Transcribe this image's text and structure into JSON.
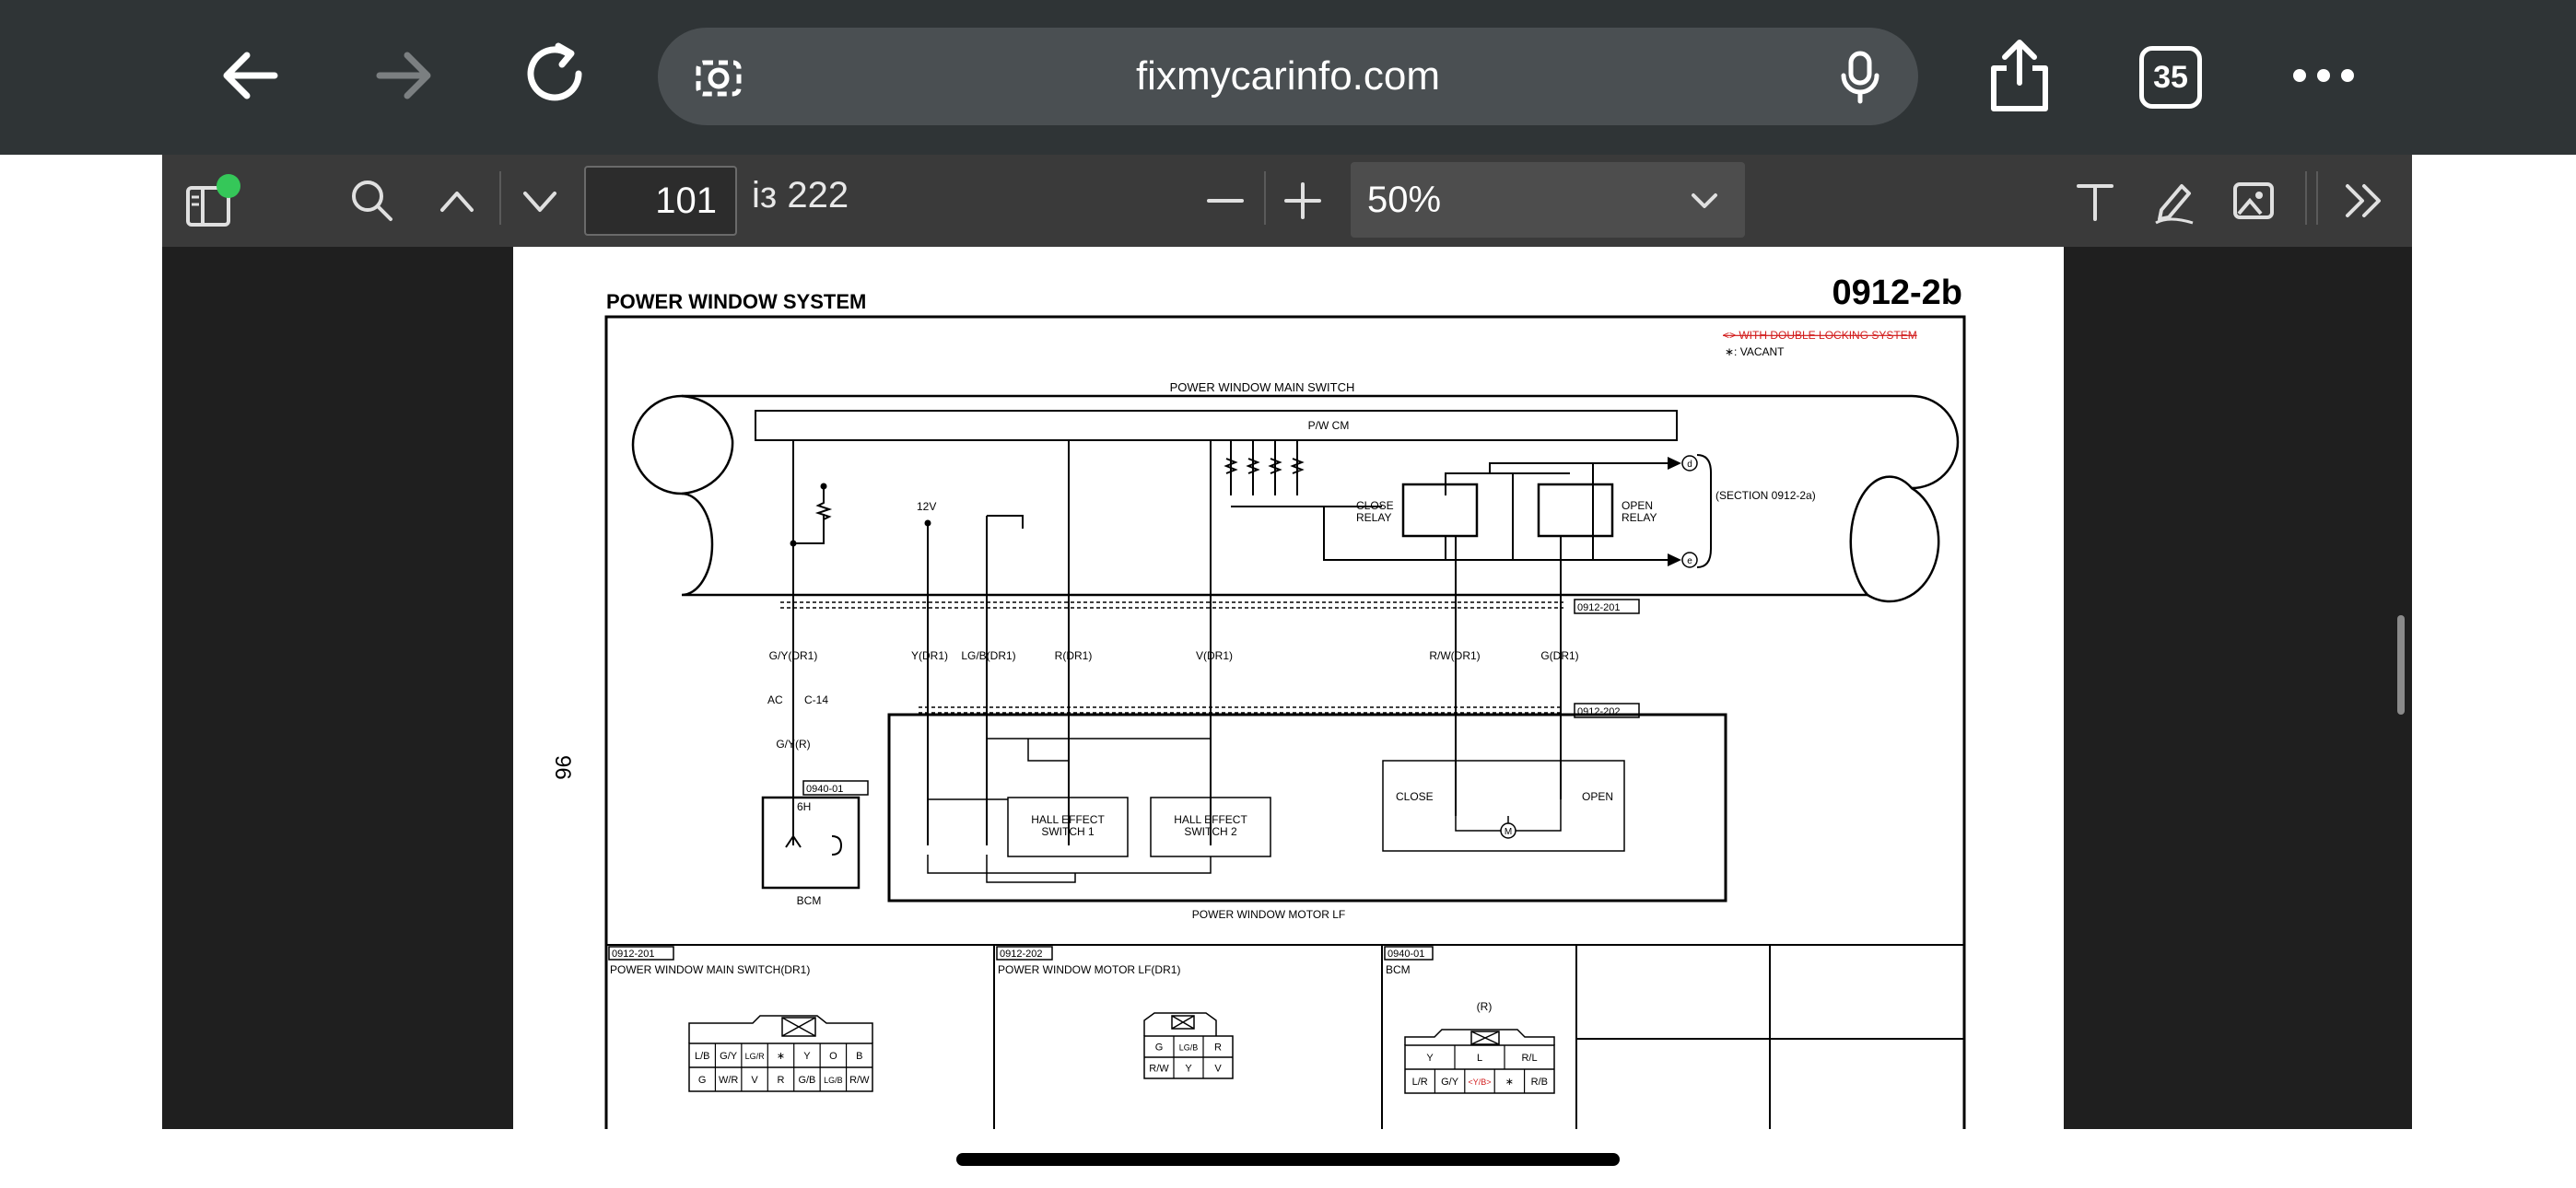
{
  "browser": {
    "url": "fixmycarinfo.com",
    "tab_count": "35"
  },
  "pdf_toolbar": {
    "page_current": "101",
    "page_total": "із 222",
    "zoom": "50%"
  },
  "document": {
    "title": "POWER WINDOW SYSTEM",
    "section_code": "0912-2b",
    "page_number": "96",
    "notes": {
      "double_locking": "<> WITH DOUBLE LOCKING SYSTEM",
      "vacant": "∗: VACANT"
    },
    "main_switch_label": "POWER WINDOW MAIN SWITCH",
    "pwcm_label": "P/W CM",
    "close_relay": [
      "CLOSE",
      "RELAY"
    ],
    "open_relay": [
      "OPEN",
      "RELAY"
    ],
    "section_ref": "(SECTION 0912-2a)",
    "term_d": "d",
    "term_e": "e",
    "v12": "12V",
    "conn_201": "0912-201",
    "conn_202": "0912-202",
    "wires": [
      "G/Y(DR1)",
      "Y(DR1)",
      "LG/B(DR1)",
      "R(DR1)",
      "V(DR1)",
      "R/W(DR1)",
      "G(DR1)"
    ],
    "ac_label": "AC",
    "c14_label": "C-14",
    "gyr_label": "G/Y(R)",
    "conn_0940": "0940-01",
    "bcm_pin": "6H",
    "bcm_label": "BCM",
    "hall1": [
      "HALL EFFECT",
      "SWITCH 1"
    ],
    "hall2": [
      "HALL EFFECT",
      "SWITCH 2"
    ],
    "close_label": "CLOSE",
    "open_label": "OPEN",
    "motor_symbol": "M",
    "motor_label": "POWER WINDOW MOTOR LF",
    "connectors": [
      {
        "code": "0912-201",
        "name": "POWER WINDOW MAIN SWITCH(DR1)"
      },
      {
        "code": "0912-202",
        "name": "POWER WINDOW MOTOR LF(DR1)"
      },
      {
        "code": "0940-01",
        "name": "BCM"
      }
    ],
    "switch_pins_top": [
      "L/B",
      "G/Y",
      "LG/R",
      "∗",
      "Y",
      "O",
      "B"
    ],
    "switch_pins_bottom": [
      "G",
      "W/R",
      "V",
      "R",
      "G/B",
      "LG/B",
      "R/W"
    ],
    "motor_pins_top": [
      "G",
      "LG/B",
      "R"
    ],
    "motor_pins_bottom": [
      "R/W",
      "Y",
      "V"
    ],
    "bcm_r": "(R)",
    "bcm_pins_top": [
      "Y",
      "L",
      "R/L"
    ],
    "bcm_pins_bottom": [
      "L/R",
      "G/Y",
      "<Y/B>",
      "∗",
      "R/B"
    ]
  }
}
